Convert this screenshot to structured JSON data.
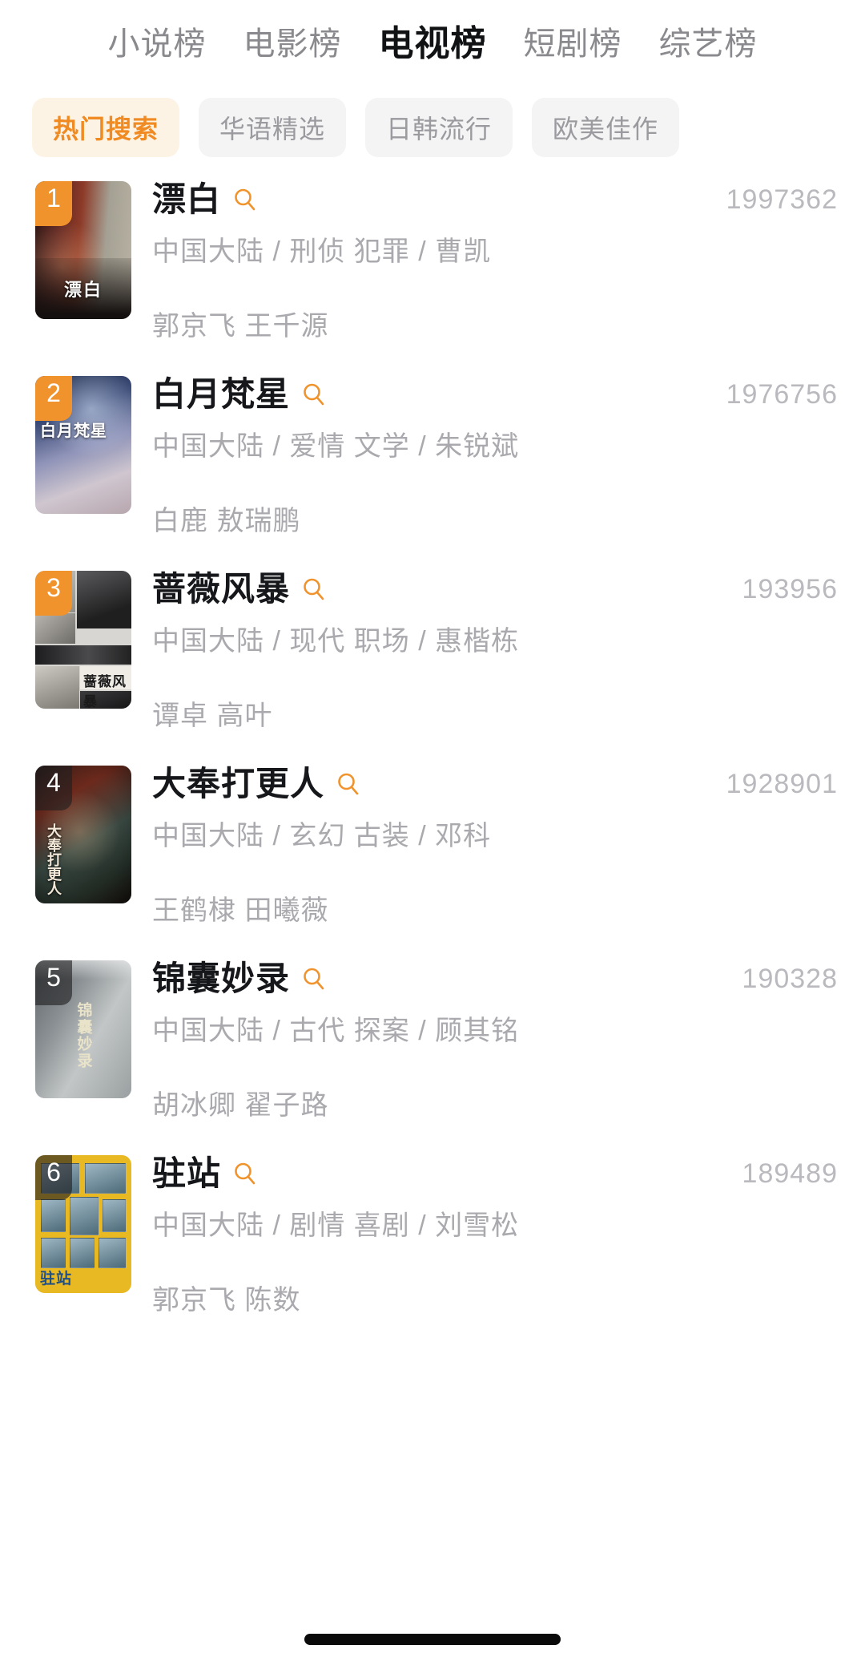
{
  "tabs": [
    {
      "label": "小说榜",
      "active": false
    },
    {
      "label": "电影榜",
      "active": false
    },
    {
      "label": "电视榜",
      "active": true
    },
    {
      "label": "短剧榜",
      "active": false
    },
    {
      "label": "综艺榜",
      "active": false
    }
  ],
  "chips": [
    {
      "label": "热门搜索",
      "active": true
    },
    {
      "label": "华语精选",
      "active": false
    },
    {
      "label": "日韩流行",
      "active": false
    },
    {
      "label": "欧美佳作",
      "active": false
    }
  ],
  "colors": {
    "accent": "#f0932c",
    "accent_text": "#ef8b22",
    "accent_chip_bg": "#fdf3e4",
    "chip_bg": "#f4f4f5",
    "chip_text": "#9a9a9f",
    "title": "#16171a",
    "meta": "#a9a9ae",
    "count": "#b9b9be",
    "tab_inactive": "#8a8a8e",
    "tab_active": "#111214"
  },
  "icons": {
    "search": "search-icon"
  },
  "list": [
    {
      "rank": "1",
      "rank_style": "accent",
      "title": "漂白",
      "meta": "中国大陆 / 刑侦 犯罪 / 曹凯",
      "cast": "郭京飞 王千源",
      "count": "1997362",
      "poster_text": "漂白"
    },
    {
      "rank": "2",
      "rank_style": "accent",
      "title": "白月梵星",
      "meta": "中国大陆 / 爱情 文学 / 朱锐斌",
      "cast": "白鹿 敖瑞鹏",
      "count": "1976756",
      "poster_text": "白月梵星"
    },
    {
      "rank": "3",
      "rank_style": "accent",
      "title": "蔷薇风暴",
      "meta": "中国大陆 / 现代 职场 / 惠楷栋",
      "cast": "谭卓 高叶",
      "count": "193956",
      "poster_text": "蔷薇风暴"
    },
    {
      "rank": "4",
      "rank_style": "dark",
      "title": "大奉打更人",
      "meta": "中国大陆 / 玄幻 古装 / 邓科",
      "cast": "王鹤棣 田曦薇",
      "count": "1928901",
      "poster_text": "大奉打更人"
    },
    {
      "rank": "5",
      "rank_style": "dark",
      "title": "锦囊妙录",
      "meta": "中国大陆 / 古代 探案 / 顾其铭",
      "cast": "胡冰卿 翟子路",
      "count": "190328",
      "poster_text": "锦囊妙录"
    },
    {
      "rank": "6",
      "rank_style": "dark",
      "title": "驻站",
      "meta": "中国大陆 / 剧情 喜剧 / 刘雪松",
      "cast": "郭京飞 陈数",
      "count": "189489",
      "poster_text": "驻站"
    }
  ]
}
